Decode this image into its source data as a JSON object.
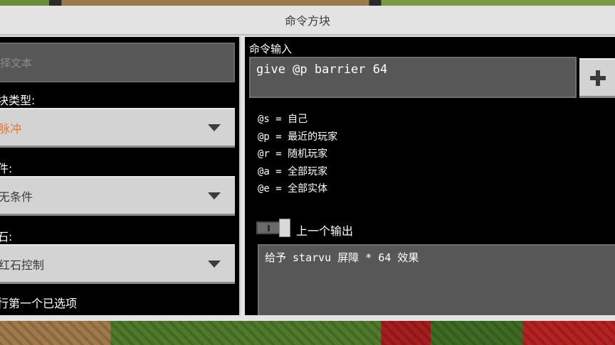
{
  "window": {
    "title": "命令方块"
  },
  "left": {
    "text_input_placeholder": "择文本",
    "block_type_label": "块类型:",
    "block_type_value": "脉冲",
    "condition_label": "件:",
    "condition_value": "无条件",
    "redstone_label": "石:",
    "redstone_value": "红石控制",
    "execute_label": "行第一个已选项"
  },
  "right": {
    "command_input_label": "命令输入",
    "command_value": "give @p barrier 64",
    "selectors": [
      "@s = 自己",
      "@p = 最近的玩家",
      "@r = 随机玩家",
      "@a = 全部玩家",
      "@e = 全部实体"
    ],
    "previous_output_label": "上一个输出",
    "output_text": "给予 starvu  屏障 * 64 效果"
  },
  "colors": {
    "accent_orange": "#e0793a",
    "panel_black": "#000000",
    "field_gray": "#575757",
    "button_gray": "#d3d3d3"
  }
}
